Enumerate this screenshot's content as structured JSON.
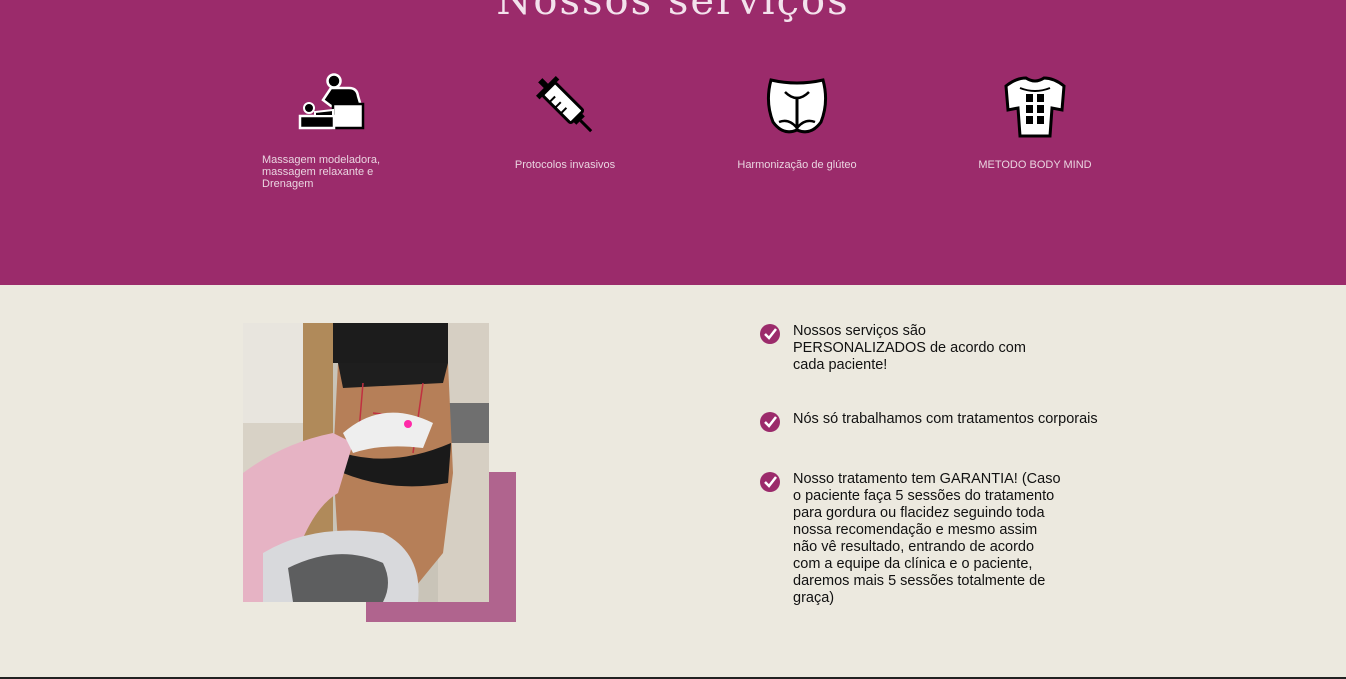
{
  "services": {
    "title": "Nossos serviços",
    "items": [
      {
        "label": "Massagem modeladora, massagem relaxante e Drenagem",
        "icon": "massage-icon"
      },
      {
        "label": "Protocolos invasivos",
        "icon": "syringe-icon"
      },
      {
        "label": "Harmonização de glúteo",
        "icon": "buttocks-icon"
      },
      {
        "label": "METODO BODY MIND",
        "icon": "torso-icon"
      }
    ],
    "colors": {
      "background": "#9b2b6b",
      "text": "#ead4e0"
    }
  },
  "features": {
    "items": [
      {
        "text": "Nossos serviços são PERSONALIZADOS de acordo com cada paciente!"
      },
      {
        "text": "Nós só trabalhamos com tratamentos corporais"
      },
      {
        "text": "Nosso tratamento tem GARANTIA! (Caso o paciente faça 5 sessões do tratamento para gordura ou flacidez seguindo toda nossa recomendação e mesmo assim não vê resultado, entrando de acordo com a equipe da clínica e o paciente, daremos mais 5 sessões totalmente de graça)"
      }
    ],
    "colors": {
      "check": "#9b2b6b",
      "background": "#ece9df",
      "accent": "#b0648e"
    }
  }
}
